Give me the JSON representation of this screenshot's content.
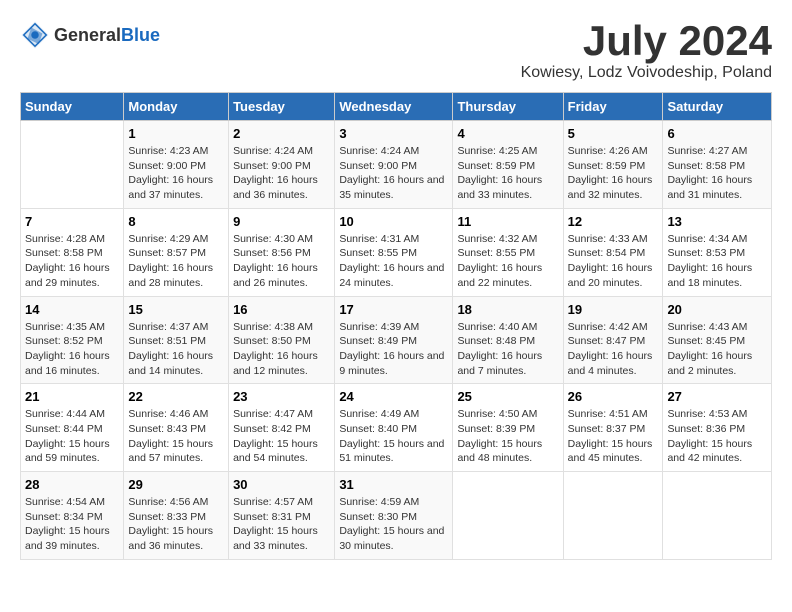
{
  "header": {
    "logo_general": "General",
    "logo_blue": "Blue",
    "month_year": "July 2024",
    "location": "Kowiesy, Lodz Voivodeship, Poland"
  },
  "days_of_week": [
    "Sunday",
    "Monday",
    "Tuesday",
    "Wednesday",
    "Thursday",
    "Friday",
    "Saturday"
  ],
  "weeks": [
    [
      {
        "date": "",
        "info": ""
      },
      {
        "date": "1",
        "info": "Sunrise: 4:23 AM\nSunset: 9:00 PM\nDaylight: 16 hours and 37 minutes."
      },
      {
        "date": "2",
        "info": "Sunrise: 4:24 AM\nSunset: 9:00 PM\nDaylight: 16 hours and 36 minutes."
      },
      {
        "date": "3",
        "info": "Sunrise: 4:24 AM\nSunset: 9:00 PM\nDaylight: 16 hours and 35 minutes."
      },
      {
        "date": "4",
        "info": "Sunrise: 4:25 AM\nSunset: 8:59 PM\nDaylight: 16 hours and 33 minutes."
      },
      {
        "date": "5",
        "info": "Sunrise: 4:26 AM\nSunset: 8:59 PM\nDaylight: 16 hours and 32 minutes."
      },
      {
        "date": "6",
        "info": "Sunrise: 4:27 AM\nSunset: 8:58 PM\nDaylight: 16 hours and 31 minutes."
      }
    ],
    [
      {
        "date": "7",
        "info": "Sunrise: 4:28 AM\nSunset: 8:58 PM\nDaylight: 16 hours and 29 minutes."
      },
      {
        "date": "8",
        "info": "Sunrise: 4:29 AM\nSunset: 8:57 PM\nDaylight: 16 hours and 28 minutes."
      },
      {
        "date": "9",
        "info": "Sunrise: 4:30 AM\nSunset: 8:56 PM\nDaylight: 16 hours and 26 minutes."
      },
      {
        "date": "10",
        "info": "Sunrise: 4:31 AM\nSunset: 8:55 PM\nDaylight: 16 hours and 24 minutes."
      },
      {
        "date": "11",
        "info": "Sunrise: 4:32 AM\nSunset: 8:55 PM\nDaylight: 16 hours and 22 minutes."
      },
      {
        "date": "12",
        "info": "Sunrise: 4:33 AM\nSunset: 8:54 PM\nDaylight: 16 hours and 20 minutes."
      },
      {
        "date": "13",
        "info": "Sunrise: 4:34 AM\nSunset: 8:53 PM\nDaylight: 16 hours and 18 minutes."
      }
    ],
    [
      {
        "date": "14",
        "info": "Sunrise: 4:35 AM\nSunset: 8:52 PM\nDaylight: 16 hours and 16 minutes."
      },
      {
        "date": "15",
        "info": "Sunrise: 4:37 AM\nSunset: 8:51 PM\nDaylight: 16 hours and 14 minutes."
      },
      {
        "date": "16",
        "info": "Sunrise: 4:38 AM\nSunset: 8:50 PM\nDaylight: 16 hours and 12 minutes."
      },
      {
        "date": "17",
        "info": "Sunrise: 4:39 AM\nSunset: 8:49 PM\nDaylight: 16 hours and 9 minutes."
      },
      {
        "date": "18",
        "info": "Sunrise: 4:40 AM\nSunset: 8:48 PM\nDaylight: 16 hours and 7 minutes."
      },
      {
        "date": "19",
        "info": "Sunrise: 4:42 AM\nSunset: 8:47 PM\nDaylight: 16 hours and 4 minutes."
      },
      {
        "date": "20",
        "info": "Sunrise: 4:43 AM\nSunset: 8:45 PM\nDaylight: 16 hours and 2 minutes."
      }
    ],
    [
      {
        "date": "21",
        "info": "Sunrise: 4:44 AM\nSunset: 8:44 PM\nDaylight: 15 hours and 59 minutes."
      },
      {
        "date": "22",
        "info": "Sunrise: 4:46 AM\nSunset: 8:43 PM\nDaylight: 15 hours and 57 minutes."
      },
      {
        "date": "23",
        "info": "Sunrise: 4:47 AM\nSunset: 8:42 PM\nDaylight: 15 hours and 54 minutes."
      },
      {
        "date": "24",
        "info": "Sunrise: 4:49 AM\nSunset: 8:40 PM\nDaylight: 15 hours and 51 minutes."
      },
      {
        "date": "25",
        "info": "Sunrise: 4:50 AM\nSunset: 8:39 PM\nDaylight: 15 hours and 48 minutes."
      },
      {
        "date": "26",
        "info": "Sunrise: 4:51 AM\nSunset: 8:37 PM\nDaylight: 15 hours and 45 minutes."
      },
      {
        "date": "27",
        "info": "Sunrise: 4:53 AM\nSunset: 8:36 PM\nDaylight: 15 hours and 42 minutes."
      }
    ],
    [
      {
        "date": "28",
        "info": "Sunrise: 4:54 AM\nSunset: 8:34 PM\nDaylight: 15 hours and 39 minutes."
      },
      {
        "date": "29",
        "info": "Sunrise: 4:56 AM\nSunset: 8:33 PM\nDaylight: 15 hours and 36 minutes."
      },
      {
        "date": "30",
        "info": "Sunrise: 4:57 AM\nSunset: 8:31 PM\nDaylight: 15 hours and 33 minutes."
      },
      {
        "date": "31",
        "info": "Sunrise: 4:59 AM\nSunset: 8:30 PM\nDaylight: 15 hours and 30 minutes."
      },
      {
        "date": "",
        "info": ""
      },
      {
        "date": "",
        "info": ""
      },
      {
        "date": "",
        "info": ""
      }
    ]
  ]
}
